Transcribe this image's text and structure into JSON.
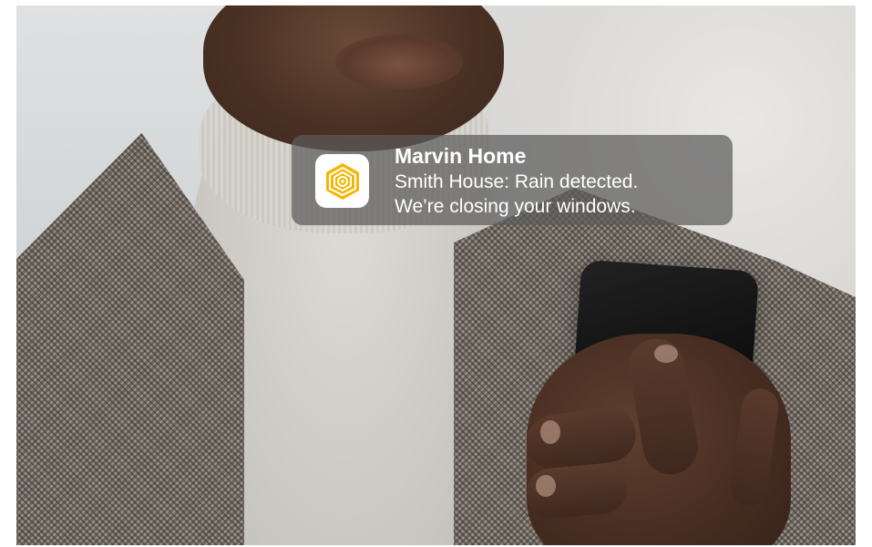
{
  "notification": {
    "app_name": "Marvin Home",
    "message_line_1": "Smith House: Rain detected.",
    "message_line_2": "We’re closing your windows.",
    "app_icon": "marvin-rose-logo-icon",
    "icon_color": "#F2B705",
    "background_color": "#5C5C5C"
  },
  "photo": {
    "subject": "photo-background"
  }
}
